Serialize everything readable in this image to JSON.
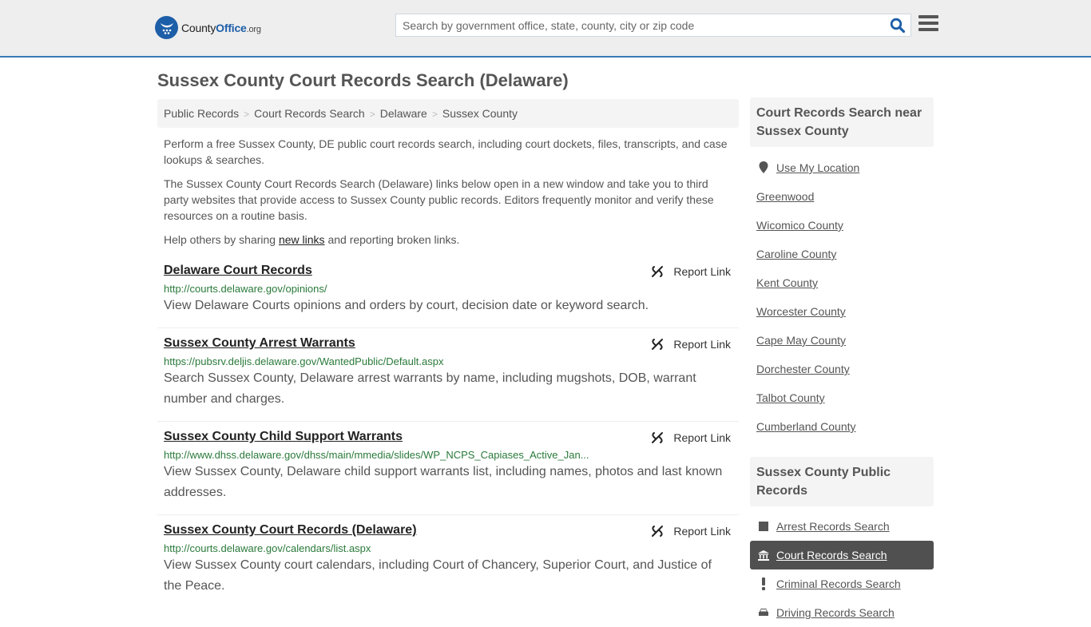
{
  "header": {
    "logo": {
      "county": "County",
      "office": "Office",
      "org": ".org"
    },
    "search_placeholder": "Search by government office, state, county, city or zip code",
    "search_value": ""
  },
  "page_title": "Sussex County Court Records Search (Delaware)",
  "breadcrumb": [
    "Public Records",
    "Court Records Search",
    "Delaware",
    "Sussex County"
  ],
  "intro": {
    "p1": "Perform a free Sussex County, DE public court records search, including court dockets, files, transcripts, and case lookups & searches.",
    "p2": "The Sussex County Court Records Search (Delaware) links below open in a new window and take you to third party websites that provide access to Sussex County public records. Editors frequently monitor and verify these resources on a routine basis.",
    "p3_before": "Help others by sharing ",
    "p3_link": "new links",
    "p3_after": " and reporting broken links."
  },
  "report_label": "Report Link",
  "records": [
    {
      "title": "Delaware Court Records",
      "url": "http://courts.delaware.gov/opinions/",
      "description": "View Delaware Courts opinions and orders by court, decision date or keyword search."
    },
    {
      "title": "Sussex County Arrest Warrants",
      "url": "https://pubsrv.deljis.delaware.gov/WantedPublic/Default.aspx",
      "description": "Search Sussex County, Delaware arrest warrants by name, including mugshots, DOB, warrant number and charges."
    },
    {
      "title": "Sussex County Child Support Warrants",
      "url": "http://www.dhss.delaware.gov/dhss/main/mmedia/slides/WP_NCPS_Capiases_Active_Jan...",
      "description": "View Sussex County, Delaware child support warrants list, including names, photos and last known addresses."
    },
    {
      "title": "Sussex County Court Records (Delaware)",
      "url": "http://courts.delaware.gov/calendars/list.aspx",
      "description": "View Sussex County court calendars, including Court of Chancery, Superior Court, and Justice of the Peace."
    }
  ],
  "sidebar": {
    "nearby_title": "Court Records Search near Sussex County",
    "use_location": "Use My Location",
    "nearby": [
      "Greenwood",
      "Wicomico County",
      "Caroline County",
      "Kent County",
      "Worcester County",
      "Cape May County",
      "Dorchester County",
      "Talbot County",
      "Cumberland County"
    ],
    "public_title": "Sussex County Public Records",
    "public_links": [
      {
        "label": "Arrest Records Search",
        "icon": "square-icon",
        "active": false
      },
      {
        "label": "Court Records Search",
        "icon": "courthouse-icon",
        "active": true
      },
      {
        "label": "Criminal Records Search",
        "icon": "exclamation-icon",
        "active": false
      },
      {
        "label": "Driving Records Search",
        "icon": "car-icon",
        "active": false
      }
    ]
  },
  "colors": {
    "accent": "#1d5ea8",
    "header_border": "#3a7ab8",
    "url_green": "#2a7a3a",
    "active_bg": "#505050"
  }
}
